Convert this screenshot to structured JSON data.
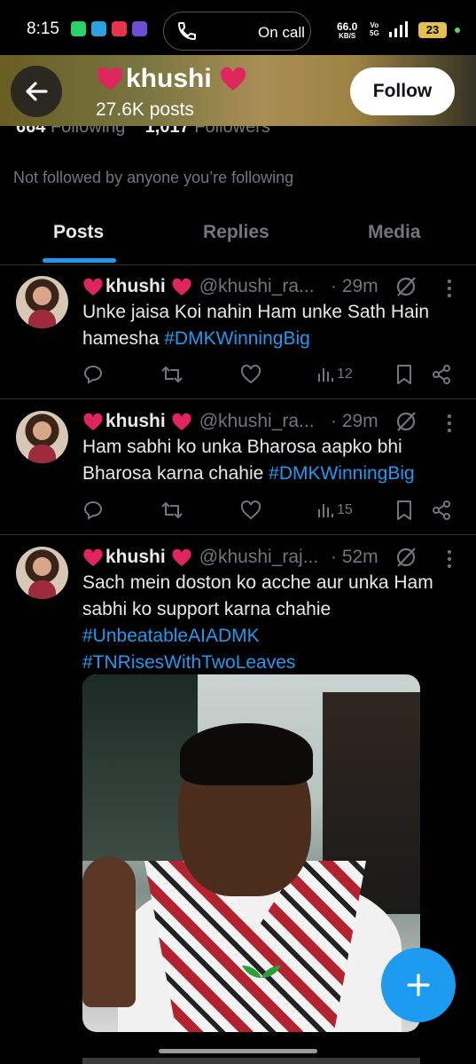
{
  "status_bar": {
    "time": "8:15",
    "call_text": "On call",
    "net_speed": "66.0",
    "net_unit": "KB/S",
    "vo_label": "Vo",
    "five_g_label": "5G",
    "battery": "23",
    "colors": {
      "whatsapp": "#25d366",
      "telegram": "#2aa3e0",
      "app3": "#e8344a",
      "app4": "#6b4dd6"
    }
  },
  "profile": {
    "name": "khushi",
    "posts_count": "27.6K posts",
    "follow_label": "Follow",
    "following_count": "664",
    "following_label": "Following",
    "followers_count": "1,017",
    "followers_label": "Followers",
    "not_followed_text": "Not followed by anyone you’re following"
  },
  "tabs": [
    {
      "label": "Posts",
      "active": true
    },
    {
      "label": "Replies",
      "active": false
    },
    {
      "label": "Media",
      "active": false
    }
  ],
  "posts": [
    {
      "name": "khushi",
      "handle": "@khushi_ra...",
      "time": "· 29m",
      "text_plain": "Unke jaisa Koi nahin Ham unke Sath Hain hamesha ",
      "hashtags": [
        "#DMKWinningBig"
      ],
      "views": "12"
    },
    {
      "name": "khushi",
      "handle": "@khushi_ra...",
      "time": "· 29m",
      "text_plain": "Ham sabhi ko unka Bharosa aapko bhi Bharosa karna chahie ",
      "hashtags": [
        "#DMKWinningBig"
      ],
      "views": "15"
    },
    {
      "name": "khushi",
      "handle": "@khushi_raj...",
      "time": "· 52m",
      "text_plain": "Sach mein doston ko acche aur unka Ham sabhi ko support karna chahie",
      "hashtags": [
        "#UnbeatableAIADMK",
        "#TNRisesWithTwoLeaves"
      ],
      "views": ""
    }
  ],
  "colors": {
    "accent": "#1d9bf0",
    "heart": "#e0245e",
    "muted": "#71767b"
  },
  "icons": {
    "back": "arrow-left-icon",
    "reply": "reply-icon",
    "repost": "repost-icon",
    "like": "like-icon",
    "views": "views-icon",
    "bookmark": "bookmark-icon",
    "share": "share-icon",
    "grok": "grok-icon",
    "more": "more-icon",
    "compose": "compose-plus-icon"
  }
}
